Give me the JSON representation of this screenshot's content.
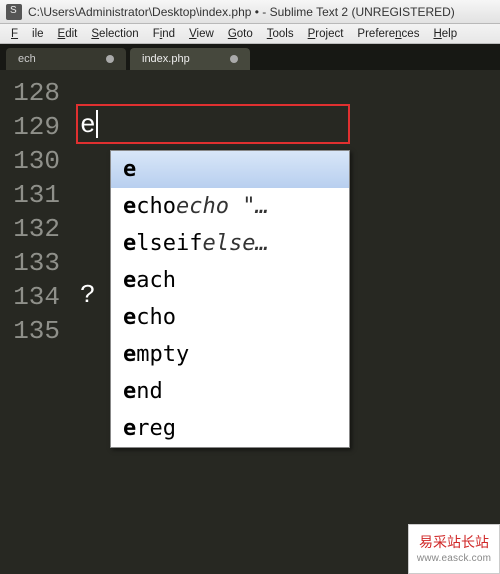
{
  "window": {
    "title": "C:\\Users\\Administrator\\Desktop\\index.php • - Sublime Text 2 (UNREGISTERED)"
  },
  "menu": {
    "items": [
      "File",
      "Edit",
      "Selection",
      "Find",
      "View",
      "Goto",
      "Tools",
      "Project",
      "Preferences",
      "Help"
    ]
  },
  "tabs": [
    {
      "label": "ech",
      "active": false,
      "dirty": true
    },
    {
      "label": "index.php",
      "active": true,
      "dirty": true
    }
  ],
  "editor": {
    "line_numbers": [
      "128",
      "129",
      "130",
      "131",
      "132",
      "133",
      "134",
      "135"
    ],
    "typed_text": "e",
    "line134_content": "?"
  },
  "autocomplete": {
    "items": [
      {
        "match": "e",
        "rest": "",
        "hint": "",
        "selected": true
      },
      {
        "match": "e",
        "rest": "cho",
        "hint": "echo  \"…",
        "selected": false
      },
      {
        "match": "e",
        "rest": "lseif",
        "hint": "else…",
        "selected": false
      },
      {
        "match": "e",
        "rest": "ach",
        "hint": "",
        "selected": false
      },
      {
        "match": "e",
        "rest": "cho",
        "hint": "",
        "selected": false
      },
      {
        "match": "e",
        "rest": "mpty",
        "hint": "",
        "selected": false
      },
      {
        "match": "e",
        "rest": "nd",
        "hint": "",
        "selected": false
      },
      {
        "match": "e",
        "rest": "reg",
        "hint": "",
        "selected": false
      }
    ]
  },
  "watermark": {
    "text": "易采站长站",
    "url": "www.easck.com"
  }
}
